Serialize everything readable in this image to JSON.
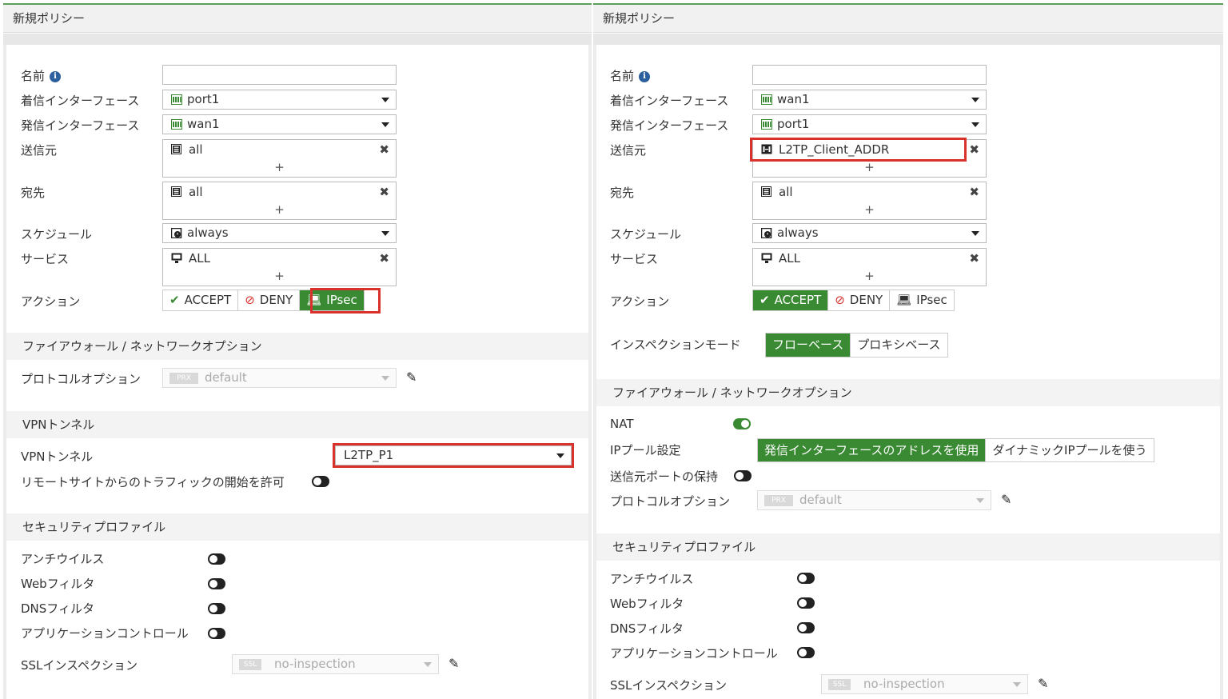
{
  "left": {
    "title": "新規ポリシー",
    "labels": {
      "name": "名前",
      "incoming": "着信インターフェース",
      "outgoing": "発信インターフェース",
      "source": "送信元",
      "destination": "宛先",
      "schedule": "スケジュール",
      "service": "サービス",
      "action": "アクション"
    },
    "values": {
      "name": "",
      "incoming": "port1",
      "outgoing": "wan1",
      "source": "all",
      "destination": "all",
      "schedule": "always",
      "service": "ALL"
    },
    "actions": [
      "ACCEPT",
      "DENY",
      "IPsec"
    ],
    "active_action": "IPsec",
    "fw_section": "ファイアウォール / ネットワークオプション",
    "protocol_label": "プロトコルオプション",
    "protocol_tag": "PRX",
    "protocol_value": "default",
    "vpn_section": "VPNトンネル",
    "vpn_label": "VPNトンネル",
    "vpn_value": "L2TP_P1",
    "remote_label": "リモートサイトからのトラフィックの開始を許可",
    "security_section": "セキュリティプロファイル",
    "antivirus": "アンチウイルス",
    "webfilter": "Webフィルタ",
    "dnsfilter": "DNSフィルタ",
    "appcontrol": "アプリケーションコントロール",
    "ssl_label": "SSLインスペクション",
    "ssl_tag": "SSL",
    "ssl_value": "no-inspection"
  },
  "right": {
    "title": "新規ポリシー",
    "labels": {
      "name": "名前",
      "incoming": "着信インターフェース",
      "outgoing": "発信インターフェース",
      "source": "送信元",
      "destination": "宛先",
      "schedule": "スケジュール",
      "service": "サービス",
      "action": "アクション"
    },
    "values": {
      "name": "",
      "incoming": "wan1",
      "outgoing": "port1",
      "source": "L2TP_Client_ADDR",
      "destination": "all",
      "schedule": "always",
      "service": "ALL"
    },
    "actions": [
      "ACCEPT",
      "DENY",
      "IPsec"
    ],
    "active_action": "ACCEPT",
    "inspection_label": "インスペクションモード",
    "inspection_modes": [
      "フローベース",
      "プロキシベース"
    ],
    "fw_section": "ファイアウォール / ネットワークオプション",
    "nat_label": "NAT",
    "ippool_label": "IPプール設定",
    "ippool_options": [
      "発信インターフェースのアドレスを使用",
      "ダイナミックIPプールを使う"
    ],
    "preserve_port_label": "送信元ポートの保持",
    "protocol_label": "プロトコルオプション",
    "protocol_tag": "PRX",
    "protocol_value": "default",
    "security_section": "セキュリティプロファイル",
    "antivirus": "アンチウイルス",
    "webfilter": "Webフィルタ",
    "dnsfilter": "DNSフィルタ",
    "appcontrol": "アプリケーションコントロール",
    "ssl_label": "SSLインスペクション",
    "ssl_tag": "SSL",
    "ssl_value": "no-inspection"
  },
  "colors": {
    "accent_green": "#3a8a34",
    "highlight_red": "#d9312b",
    "info_blue": "#2c5f9e"
  }
}
